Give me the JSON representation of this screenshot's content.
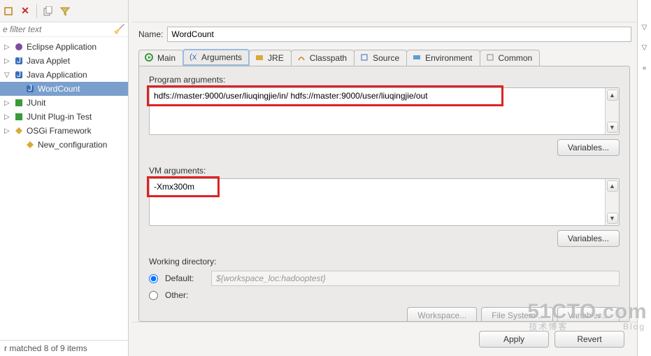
{
  "filter_placeholder": "e filter text",
  "tree": [
    {
      "label": "Eclipse Application",
      "icon": "eclipse",
      "expandable": true
    },
    {
      "label": "Java Applet",
      "icon": "java",
      "expandable": true
    },
    {
      "label": "Java Application",
      "icon": "java",
      "expandable": true,
      "expanded": true
    },
    {
      "label": "WordCount",
      "icon": "java",
      "child": true,
      "selected": true
    },
    {
      "label": "JUnit",
      "icon": "junit",
      "expandable": true
    },
    {
      "label": "JUnit Plug-in Test",
      "icon": "junit",
      "expandable": true
    },
    {
      "label": "OSGi Framework",
      "icon": "osgi",
      "expandable": true
    },
    {
      "label": "New_configuration",
      "icon": "osgi",
      "child": true
    }
  ],
  "status_text": "r matched 8 of 9 items",
  "name_label": "Name:",
  "name_value": "WordCount",
  "tabs": [
    {
      "label": "Main",
      "icon": "main"
    },
    {
      "label": "Arguments",
      "icon": "args",
      "active": true
    },
    {
      "label": "JRE",
      "icon": "jre"
    },
    {
      "label": "Classpath",
      "icon": "classpath"
    },
    {
      "label": "Source",
      "icon": "source"
    },
    {
      "label": "Environment",
      "icon": "env"
    },
    {
      "label": "Common",
      "icon": "common"
    }
  ],
  "program_args_label": "Program arguments:",
  "program_args_value": "hdfs://master:9000/user/liuqingjie/in/ hdfs://master:9000/user/liuqingjie/out",
  "vm_args_label": "VM arguments:",
  "vm_args_value": "-Xmx300m",
  "variables_btn": "Variables...",
  "working_dir_label": "Working directory:",
  "default_label": "Default:",
  "default_value": "${workspace_loc:hadooptest}",
  "other_label": "Other:",
  "workspace_btn": "Workspace...",
  "filesystem_btn": "File System...",
  "apply_btn": "Apply",
  "revert_btn": "Revert",
  "watermark_big": "51CTO.com",
  "watermark_small_left": "技术博客",
  "watermark_small_right": "Blog"
}
